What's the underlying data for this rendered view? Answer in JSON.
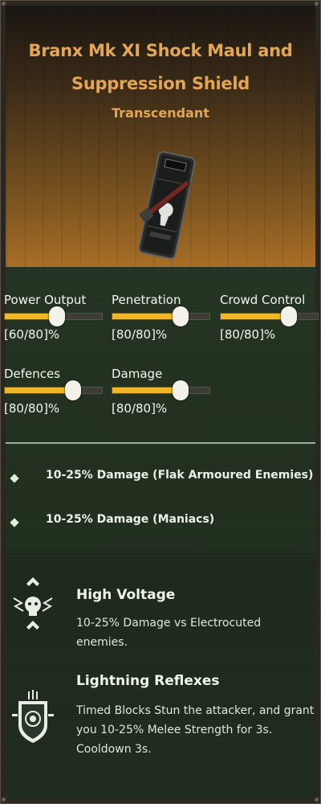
{
  "item": {
    "name_line1": "Branx Mk XI Shock Maul and",
    "name_line2": "Suppression Shield",
    "rarity": "Transcendant"
  },
  "colors": {
    "accent": "#e3a652",
    "bar_fill": "#efb629"
  },
  "stats": [
    {
      "label": "Power Output",
      "value": "[60/80]%",
      "fill": 0.54
    },
    {
      "label": "Penetration",
      "value": "[80/80]%",
      "fill": 0.7
    },
    {
      "label": "Crowd Control",
      "value": "[80/80]%",
      "fill": 0.7
    },
    {
      "label": "Defences",
      "value": "[80/80]%",
      "fill": 0.7
    },
    {
      "label": "Damage",
      "value": "[80/80]%",
      "fill": 0.7
    }
  ],
  "blessings": [
    {
      "text": "10-25% Damage (Flak Armoured Enemies)"
    },
    {
      "text": "10-25% Damage (Maniacs)"
    }
  ],
  "perks": [
    {
      "title": "High Voltage",
      "description": "10-25% Damage vs Electrocuted enemies.",
      "icon": "high-voltage-icon"
    },
    {
      "title": "Lightning Reflexes",
      "description": "Timed Blocks Stun the attacker, and grant you 10-25% Melee Strength for 3s. Cooldown 3s.",
      "icon": "lightning-reflexes-icon"
    }
  ]
}
